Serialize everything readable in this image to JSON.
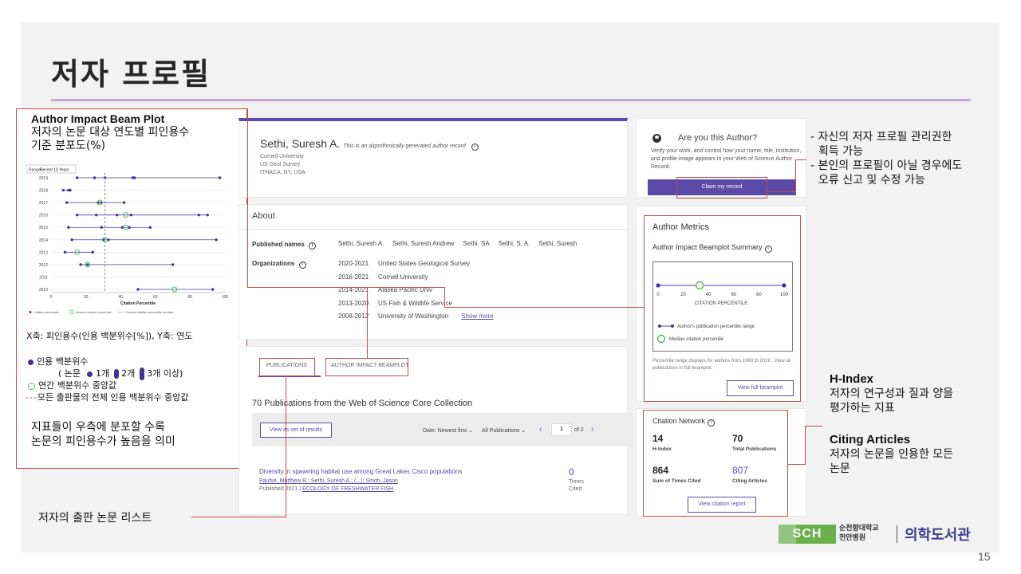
{
  "slide": {
    "title": "저자 프로필",
    "page_number": "15"
  },
  "beamplot_box": {
    "title": "Author Impact Beam Plot",
    "desc_line1": "저자의 논문 대상 연도별 피인용수",
    "desc_line2": "기준 분포도(%)",
    "axis_note": "X축: 피인용수(인용 백분위수[%]), Y축: 연도",
    "legend_citation": "인용 백분위수",
    "legend_counts_prefix": "( 논문",
    "legend_count1": "1개",
    "legend_count2": "2개",
    "legend_count3": "3개 이상)",
    "legend_median": "연간 백분위수 중앙값",
    "legend_overall": "모든 출판물의 전체 인용 백분위수 중앙값",
    "foot_line1": "지표들이 우측에 분포할 수록",
    "foot_line2": "논문의 피인용수가 높음을 의미"
  },
  "mini_chart": {
    "range_label": "Range:",
    "range_value": "Recent 10 Years",
    "years": [
      "2019",
      "2018",
      "2017",
      "2016",
      "2015",
      "2014",
      "2013",
      "2012",
      "2011",
      "2010"
    ],
    "x_ticks": [
      "0",
      "20",
      "40",
      "60",
      "80",
      "100"
    ],
    "xlabel": "Citation Percentile",
    "legend": [
      "Citation percentile",
      "Annual citation percentile",
      "Overall citation percentile median"
    ]
  },
  "chart_data": {
    "type": "scatter",
    "title": "",
    "xlabel": "Citation Percentile",
    "ylabel": "",
    "xlim": [
      0,
      100
    ],
    "overall_median": 31,
    "rows": [
      {
        "year": "2019",
        "range": [
          15,
          97
        ],
        "points": [
          15,
          25,
          31,
          47,
          48,
          97
        ],
        "median": null
      },
      {
        "year": "2018",
        "range": [
          7,
          11
        ],
        "points": [
          7,
          10,
          11
        ],
        "median": null
      },
      {
        "year": "2017",
        "range": [
          9,
          42
        ],
        "points": [
          9,
          27,
          29,
          42
        ],
        "median": 28
      },
      {
        "year": "2016",
        "range": [
          15,
          90
        ],
        "points": [
          15,
          26,
          38,
          46,
          85,
          90
        ],
        "median": 43
      },
      {
        "year": "2015",
        "range": [
          10,
          57
        ],
        "points": [
          10,
          29,
          41,
          45,
          57
        ],
        "median": 43
      },
      {
        "year": "2014",
        "range": [
          12,
          95
        ],
        "points": [
          12,
          30,
          33,
          95
        ],
        "median": 31
      },
      {
        "year": "2013",
        "range": [
          8,
          24
        ],
        "points": [
          8,
          24
        ],
        "median": 15
      },
      {
        "year": "2012",
        "range": [
          17,
          70
        ],
        "points": [
          17,
          21,
          70
        ],
        "median": 21
      },
      {
        "year": "2011",
        "range": null,
        "points": [],
        "median": null
      },
      {
        "year": "2010",
        "range": [
          50,
          93
        ],
        "points": [
          50,
          93
        ],
        "median": 71
      }
    ]
  },
  "author": {
    "name": "Sethi, Suresh A.",
    "generated_note": "This is an algorithmically generated author record",
    "aff1": "Cornell University",
    "aff2": "US Geol Survey",
    "aff3": "ITHACA, NY, USA"
  },
  "about": {
    "title": "About",
    "published_names_label": "Published names",
    "published_names": [
      "Sethi, Suresh A.",
      "Sethi, Suresh Andrew",
      "Sethi, SA",
      "Sethi, S. A.",
      "Sethi, Suresh"
    ],
    "organizations_label": "Organizations",
    "organizations": [
      {
        "years": "2020-2021",
        "name": "United States Geological Survey"
      },
      {
        "years": "2016-2021",
        "name": "Cornell University"
      },
      {
        "years": "2014-2021",
        "name": "Alaska Pacific Univ"
      },
      {
        "years": "2013-2020",
        "name": "US Fish & Wildlife Service"
      },
      {
        "years": "2008-2012",
        "name": "University of Washington"
      }
    ],
    "show_more": "Show more"
  },
  "pubs": {
    "tab1": "PUBLICATIONS",
    "tab2": "AUTHOR IMPACT BEAMPLOT",
    "heading": "70 Publications from the Web of Science Core Collection",
    "view_btn": "View as set of results",
    "sort": "Date: Newest first ⌄",
    "filter": "All Publications ⌄",
    "page": "1",
    "of_pages": "of 2",
    "paper_title": "Diversity in spawning habitat use among Great Lakes Cisco populations",
    "paper_authors": "Paufve, Matthew R.; Sethi, Suresh A.; (...); Smith, Jason",
    "paper_pub_prefix": "Published 2021 |",
    "paper_journal": "ECOLOGY OF FRESHWATER FISH",
    "times_cited": "0",
    "times_label1": "Times",
    "times_label2": "Cited"
  },
  "claim": {
    "heading": "Are you this Author?",
    "desc": "Verify your work, and control how your name, title, institution, and profile image appears in your Web of Science Author Record.",
    "button": "Claim my record"
  },
  "metrics": {
    "heading": "Author Metrics",
    "subheading": "Author Impact Beamplot Summary",
    "ticks": [
      "0",
      "20",
      "40",
      "60",
      "80",
      "100"
    ],
    "axis_label": "CITATION PERCENTILE",
    "legend_range": "Author's publication percentile range",
    "legend_median": "Median citation percentile",
    "range": [
      0,
      100
    ],
    "median": 33,
    "foot": "Percentile range displays for authors from 1980 to 2019 . View all publications in full beamplot.",
    "button": "View full beamplot"
  },
  "network": {
    "heading": "Citation Network",
    "h_index": "14",
    "h_index_label": "H-Index",
    "total_pubs": "70",
    "total_pubs_label": "Total Publications",
    "sum_cited": "864",
    "sum_cited_label": "Sum of Times Cited",
    "citing_articles": "807",
    "citing_articles_label": "Citing Articles",
    "button": "View citation report"
  },
  "annotations": {
    "claim_note1": "- 자신의 저자 프로필 관리권한",
    "claim_note2": "획득 가능",
    "claim_note3": "- 본인의 프로필이 아닐 경우에도",
    "claim_note4": "오류 신고 및 수정 가능",
    "hindex_title": "H-Index",
    "hindex_desc1": "저자의 연구성과 질과 양을",
    "hindex_desc2": "평가하는 지표",
    "citing_title": "Citing Articles",
    "citing_desc1": "저자의 논문을 인용한 모든",
    "citing_desc2": "논문",
    "pub_list_note": "저자의 출판 논문 리스트"
  },
  "logo": {
    "mark": "SCH",
    "line1": "순천향대학교",
    "line2": "천안병원",
    "library": "의학도서관"
  },
  "colors": {
    "accent": "#5b4aa8",
    "annotation_red": "#c0504d",
    "median_green": "#59b75b",
    "rule": "#c6a6d6"
  }
}
